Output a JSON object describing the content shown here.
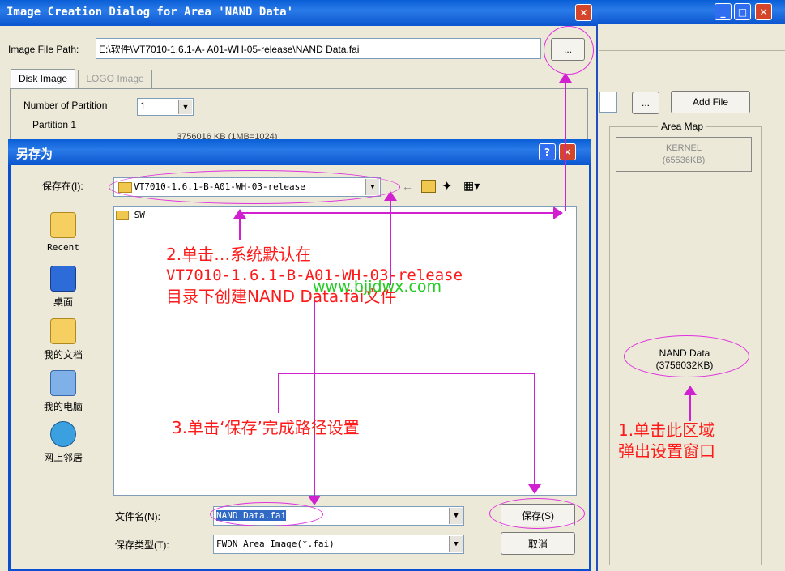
{
  "bg_window": {
    "area_map_label": "Area Map",
    "add_file_label": "Add File",
    "browse_label": "...",
    "kernel": {
      "name": "KERNEL",
      "size": "(65536KB)"
    },
    "nand": {
      "name": "NAND Data",
      "size": "(3756032KB)"
    }
  },
  "main_dialog": {
    "title": "Image Creation Dialog for Area 'NAND Data'",
    "image_file_path_label": "Image File Path:",
    "image_file_path_value": "E:\\软件\\VT7010-1.6.1-A- A01-WH-05-release\\NAND Data.fai",
    "browse_label": "...",
    "tabs": [
      "Disk Image",
      "LOGO Image"
    ],
    "num_partition_label": "Number of Partition",
    "num_partition_value": "1",
    "partition1_label": "Partition 1",
    "partition_size_partial": "3756016  KB (1MB=1024)"
  },
  "save_dialog": {
    "title": "另存为",
    "save_in_label": "保存在(I):",
    "save_in_value": "VT7010-1.6.1-B-A01-WH-03-release",
    "folder_item": "SW",
    "places": [
      "Recent",
      "桌面",
      "我的文档",
      "我的电脑",
      "网上邻居"
    ],
    "filename_label": "文件名(N):",
    "filename_value": "NAND Data.fai",
    "filetype_label": "保存类型(T):",
    "filetype_value": "FWDN Area Image(*.fai)",
    "save_button": "保存(S)",
    "cancel_button": "取消"
  },
  "annotations": {
    "step2_line1": "2.单击…系统默认在",
    "step2_line2": "VT7010-1.6.1-B-A01-WH-03-release",
    "step2_line3": "目录下创建NAND Data.fai文件",
    "watermark": "www.bjjdwx.com",
    "step3": "3.单击‘保存’完成路径设置",
    "step1_line1": "1.单击此区域",
    "step1_line2": "弹出设置窗口"
  },
  "colors": {
    "annotation_red": "#ff1a1a",
    "annotation_magenta": "#d020d0",
    "watermark_green": "#22cc22",
    "xp_blue": "#0a5fd6"
  }
}
